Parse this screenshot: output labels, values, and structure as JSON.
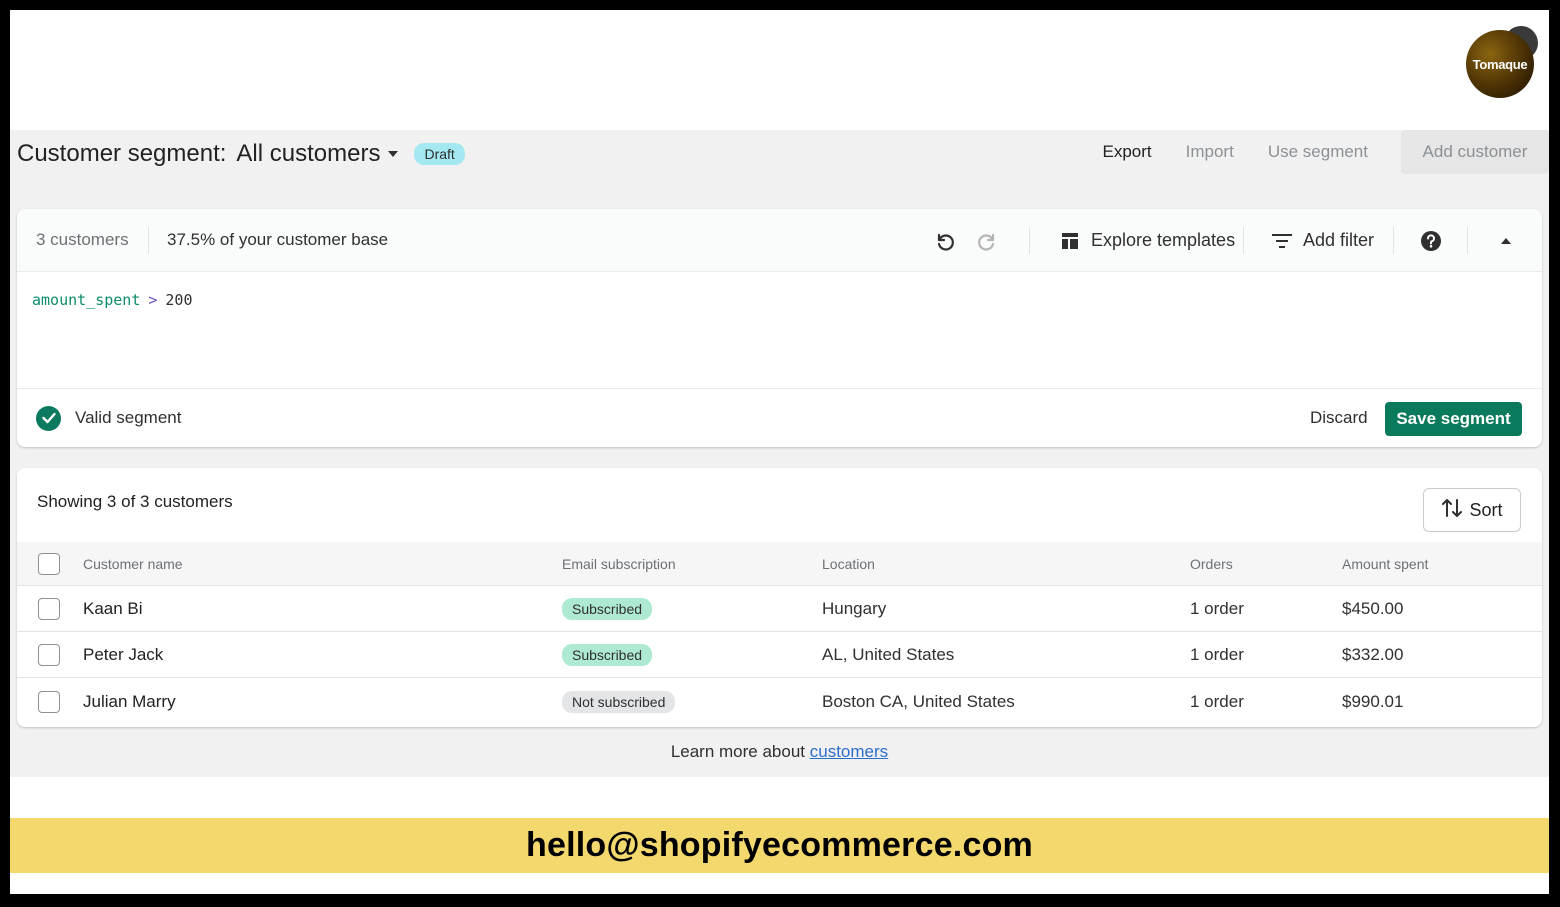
{
  "logo": {
    "text": "Tomaque"
  },
  "header": {
    "title_prefix": "Customer segment:",
    "segment_name": "All customers",
    "badge": "Draft",
    "actions": {
      "export": "Export",
      "import": "Import",
      "use_segment": "Use segment",
      "add_customer": "Add customer"
    }
  },
  "editor": {
    "customer_count": "3 customers",
    "percent_base": "37.5% of your customer base",
    "explore_templates": "Explore templates",
    "add_filter": "Add filter",
    "query": {
      "field": "amount_spent",
      "operator": ">",
      "value": "200"
    },
    "valid_label": "Valid segment",
    "discard": "Discard",
    "save": "Save segment"
  },
  "list": {
    "showing": "Showing 3 of 3 customers",
    "sort": "Sort",
    "columns": [
      "Customer name",
      "Email subscription",
      "Location",
      "Orders",
      "Amount spent"
    ],
    "rows": [
      {
        "name": "Kaan Bi",
        "subscription": "Subscribed",
        "subscribed": true,
        "location": "Hungary",
        "orders": "1 order",
        "amount": "$450.00"
      },
      {
        "name": "Peter Jack",
        "subscription": "Subscribed",
        "subscribed": true,
        "location": "AL, United States",
        "orders": "1 order",
        "amount": "$332.00"
      },
      {
        "name": "Julian Marry",
        "subscription": "Not subscribed",
        "subscribed": false,
        "location": "Boston CA, United States",
        "orders": "1 order",
        "amount": "$990.01"
      }
    ]
  },
  "footer": {
    "learn_prefix": "Learn more about",
    "learn_link": "customers"
  },
  "banner": {
    "email": "hello@shopifyecommerce.com"
  },
  "colors": {
    "save_green": "#0b7a5c",
    "subscribed_bg": "#aee9d1",
    "draft_bg": "#a4e8f2",
    "banner_yellow": "#f2d86d"
  }
}
